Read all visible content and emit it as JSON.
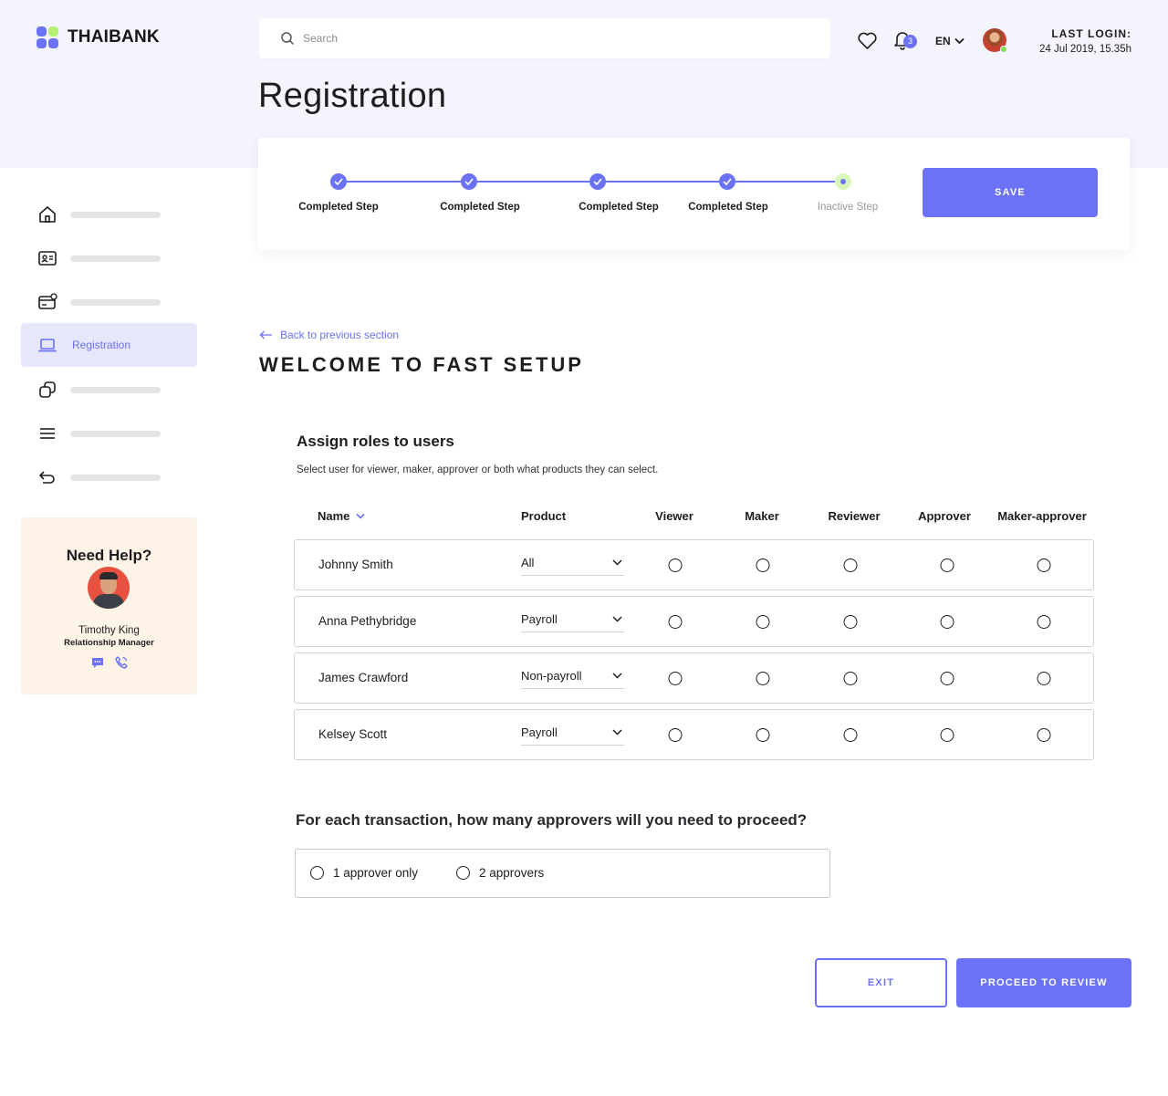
{
  "brand": {
    "name": "THAIBANK"
  },
  "header": {
    "search_placeholder": "Search",
    "notification_count": "3",
    "language": "EN",
    "last_login_label": "LAST LOGIN:",
    "last_login_value": "24 Jul 2019, 15.35h"
  },
  "page": {
    "title": "Registration"
  },
  "stepper": {
    "steps": [
      {
        "label": "Completed Step",
        "state": "completed"
      },
      {
        "label": "Completed Step",
        "state": "completed"
      },
      {
        "label": "Completed Step",
        "state": "completed"
      },
      {
        "label": "Completed Step",
        "state": "completed"
      },
      {
        "label": "Inactive Step",
        "state": "inactive"
      }
    ],
    "save_label": "SAVE"
  },
  "sidebar": {
    "items": [
      {
        "icon": "home-icon",
        "label": ""
      },
      {
        "icon": "contact-card-icon",
        "label": ""
      },
      {
        "icon": "card-settings-icon",
        "label": ""
      },
      {
        "icon": "laptop-icon",
        "label": "Registration",
        "active": true
      },
      {
        "icon": "copy-icon",
        "label": ""
      },
      {
        "icon": "menu-icon",
        "label": ""
      },
      {
        "icon": "undo-icon",
        "label": ""
      }
    ]
  },
  "help": {
    "title": "Need Help?",
    "name": "Timothy King",
    "role": "Relationship Manager"
  },
  "main": {
    "back_label": "Back to previous section",
    "section_title": "WELCOME TO FAST SETUP",
    "roles_title": "Assign roles to users",
    "roles_desc": "Select user for viewer, maker, approver or both what products they can select.",
    "columns": {
      "name": "Name",
      "product": "Product",
      "viewer": "Viewer",
      "maker": "Maker",
      "reviewer": "Reviewer",
      "approver": "Approver",
      "maker_approver": "Maker-approver"
    },
    "users": [
      {
        "name": "Johnny Smith",
        "product": "All"
      },
      {
        "name": "Anna Pethybridge",
        "product": "Payroll"
      },
      {
        "name": "James Crawford",
        "product": "Non-payroll"
      },
      {
        "name": "Kelsey Scott",
        "product": "Payroll"
      }
    ],
    "approvers_question": "For each transaction, how many approvers will you need to proceed?",
    "approver_options": [
      "1 approver only",
      "2 approvers"
    ]
  },
  "actions": {
    "exit_label": "EXIT",
    "proceed_label": "PROCEED TO REVIEW"
  },
  "colors": {
    "accent": "#6b72f5",
    "band": "#f4f4fc",
    "help_bg": "#fdf3e6",
    "inactive_dot": "#d9f7b8"
  }
}
